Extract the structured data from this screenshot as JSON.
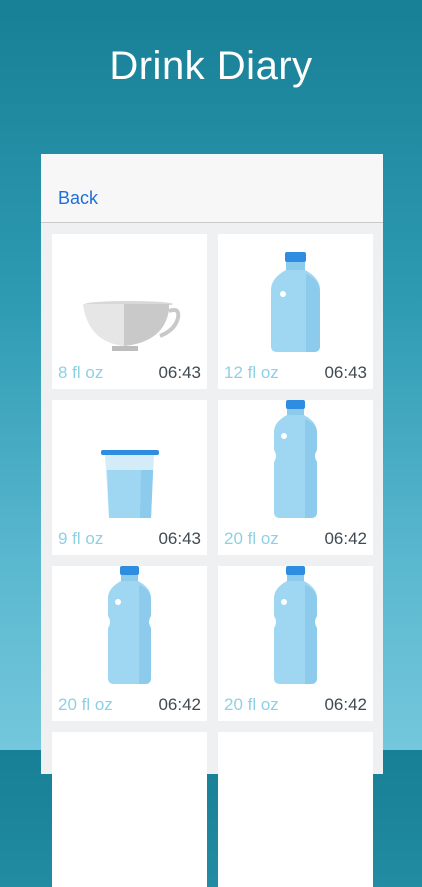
{
  "app": {
    "title": "Drink Diary"
  },
  "nav": {
    "back_label": "Back"
  },
  "entries": [
    {
      "vessel": "cup-icon",
      "amount": "8 fl oz",
      "time": "06:43"
    },
    {
      "vessel": "small-bottle-icon",
      "amount": "12 fl oz",
      "time": "06:43"
    },
    {
      "vessel": "glass-icon",
      "amount": "9 fl oz",
      "time": "06:43"
    },
    {
      "vessel": "large-bottle-icon",
      "amount": "20 fl oz",
      "time": "06:42"
    },
    {
      "vessel": "large-bottle-icon",
      "amount": "20 fl oz",
      "time": "06:42"
    },
    {
      "vessel": "large-bottle-icon",
      "amount": "20 fl oz",
      "time": "06:42"
    }
  ],
  "colors": {
    "accent": "#1f6fd8",
    "amount_text": "#8ed0e4",
    "bottle_body": "#9fd6f2",
    "bottle_cap": "#2e8de0"
  }
}
